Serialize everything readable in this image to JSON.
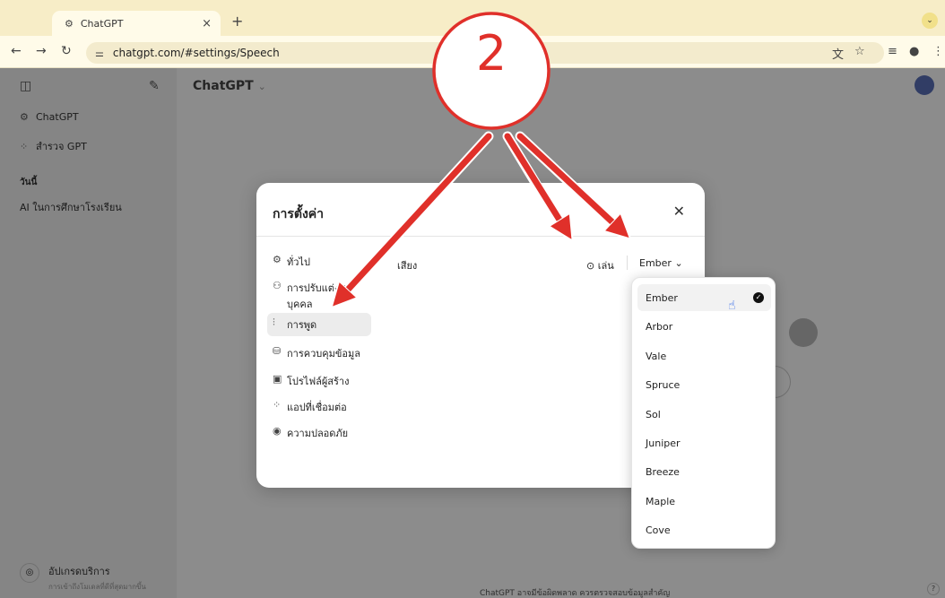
{
  "browser": {
    "tab_title": "ChatGPT",
    "tab_close": "×",
    "new_tab": "+",
    "url": "chatgpt.com/#settings/Speech"
  },
  "sidebar": {
    "items": [
      {
        "label": "ChatGPT",
        "icon": "openai-logo-icon"
      },
      {
        "label": "สำรวจ GPT",
        "icon": "grid-icon"
      }
    ],
    "section_heading": "วันนี้",
    "history": [
      "AI ในการศึกษาโรงเรียน"
    ],
    "upgrade_title": "อัปเกรดบริการ",
    "upgrade_subtitle": "การเข้าถึงโมเดลที่ดีที่สุดมากขึ้น"
  },
  "main": {
    "title": "ChatGPT",
    "footer_note": "ChatGPT อาจมีข้อผิดพลาด ควรตรวจสอบข้อมูลสำคัญ",
    "help": "?"
  },
  "settings": {
    "title": "การตั้งค่า",
    "menu": [
      {
        "label": "ทั่วไป",
        "icon": "gear-icon"
      },
      {
        "label": "การปรับแต่งเอง บุคคล",
        "icon": "person-icon"
      },
      {
        "label": "การพูด",
        "icon": "waveform-icon",
        "active": true
      },
      {
        "label": "การควบคุมข้อมูล",
        "icon": "database-icon"
      },
      {
        "label": "โปรไฟล์ผู้สร้าง",
        "icon": "id-card-icon"
      },
      {
        "label": "แอปที่เชื่อมต่อ",
        "icon": "apps-icon"
      },
      {
        "label": "ความปลอดภัย",
        "icon": "shield-icon"
      }
    ],
    "voice_label": "เสียง",
    "play_label": "เล่น",
    "selected_voice": "Ember"
  },
  "voice_options": [
    "Ember",
    "Arbor",
    "Vale",
    "Spruce",
    "Sol",
    "Juniper",
    "Breeze",
    "Maple",
    "Cove"
  ],
  "annotation": {
    "number": "2",
    "color": "#e0302a"
  },
  "colors": {
    "accent": "#e0302a",
    "browser_chrome": "#f7edc7",
    "sidebar": "#f2f2f2"
  }
}
